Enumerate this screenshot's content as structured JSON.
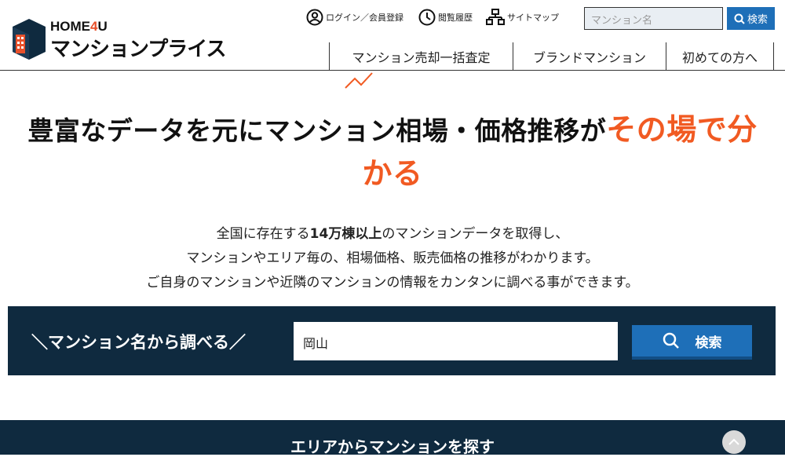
{
  "logo": {
    "top_prefix": "HOME",
    "top_four": "4",
    "top_suffix": "U",
    "bottom": "マンションプライス"
  },
  "util": {
    "login": "ログイン／会員登録",
    "history": "閲覧履歴",
    "sitemap": "サイトマップ"
  },
  "header_search": {
    "placeholder": "マンション名",
    "button": "検索"
  },
  "nav": [
    "マンション売却一括査定",
    "ブランドマンション",
    "初めての方へ"
  ],
  "hero": {
    "title_main": "豊富なデータを元にマンション相場・価格推移が",
    "title_accent_1": "その場で分",
    "title_accent_2": "かる"
  },
  "description": {
    "line1_pre": "全国に存在する",
    "line1_bold": "14万棟以上",
    "line1_post": "のマンションデータを取得し、",
    "line2": "マンションやエリア毎の、相場価格、販売価格の推移がわかります。",
    "line3": "ご自身のマンションや近隣のマンションの情報をカンタンに調べる事ができます。"
  },
  "search_band": {
    "label": "＼マンション名から調べる／",
    "value": "岡山",
    "button": "検索"
  },
  "area_band": {
    "title": "エリアからマンションを探す"
  },
  "colors": {
    "accent": "#f15a22",
    "navy": "#0f2a3f",
    "blue": "#1e6fb8"
  },
  "icons": [
    "user-circle-icon",
    "clock-icon",
    "sitemap-icon",
    "search-icon",
    "chevron-up-icon"
  ]
}
